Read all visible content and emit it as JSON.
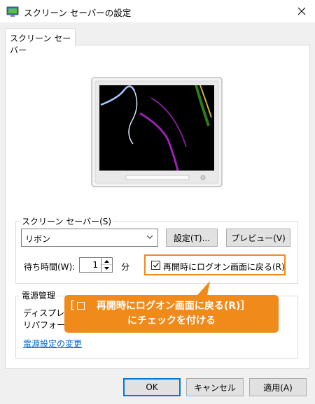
{
  "window": {
    "title": "スクリーン セーバーの設定"
  },
  "tab": {
    "label": "スクリーン セーバー"
  },
  "screensaver_group": {
    "label": "スクリーン セーバー(S)",
    "selected": "リボン",
    "settings_button": "設定(T)...",
    "preview_button": "プレビュー(V)",
    "wait_label": "待ち時間(W):",
    "wait_value": "1",
    "wait_unit": "分",
    "resume_checkbox_label": "再開時にログオン画面に戻る(R)",
    "resume_checked": true
  },
  "power_group": {
    "label": "電源管理",
    "text_line1": "ディスプレイ",
    "text_line2": "リパフォーマン",
    "link": "電源設定の変更"
  },
  "callout": {
    "bracket_open": "［",
    "line1_text": "再開時にログオン画面に戻る(R)",
    "bracket_close": "］",
    "line2": "にチェックを付ける",
    "color": "#f08a1a"
  },
  "buttons": {
    "ok": "OK",
    "cancel": "キャンセル",
    "apply": "適用(A)"
  }
}
